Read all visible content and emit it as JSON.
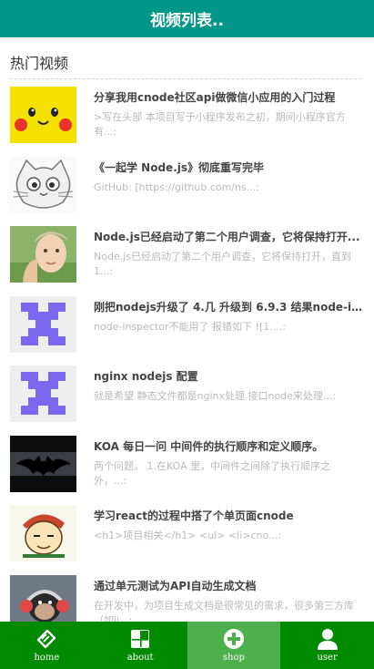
{
  "header": {
    "title": "视频列表.."
  },
  "section": {
    "title": "热门视频"
  },
  "videos": [
    {
      "title": "分享我用cnode社区api做微信小应用的入门过程",
      "summary": ">写在头部  本项目写于小程序发布之初，期间小程序官方有...:",
      "thumb": "pikachu"
    },
    {
      "title": "《一起学 Node.js》彻底重写完毕",
      "summary": "GitHub: [https://github.com/ns...:",
      "thumb": "cat-sketch"
    },
    {
      "title": "Node.js已经启动了第二个用户调查，它将保持打开...",
      "summary": "Node.js已经启动了第二个用户调查，它将保持打开，直到1...:",
      "thumb": "portrait"
    },
    {
      "title": "刚把nodejs升级了 4.几 升级到 6.9.3 结果node-ins...",
      "summary": "node-inspector不能用了 报错如下 ![1....:",
      "thumb": "identicon"
    },
    {
      "title": "nginx nodejs 配置",
      "summary": "就是希望 静态文件都是nginx处理 接口node来处理...:",
      "thumb": "identicon"
    },
    {
      "title": "KOA 每日一问 中间件的执行顺序和定义顺序。",
      "summary": "两个问题。 1.在KOA 里，中间件之间除了执行顺序之外，...:",
      "thumb": "batman"
    },
    {
      "title": "学习react的过程中搭了个单页面cnode",
      "summary": "<h1>项目相关</h1> <ul> <li>cno...:",
      "thumb": "cartoon-guy"
    },
    {
      "title": "通过单元测试为API自动生成文档",
      "summary": "在开发中，为项目生成文档是很常见的需求，很多第三方库（如jj...:",
      "thumb": "monkey-headphones"
    }
  ],
  "tabs": [
    {
      "label": "home",
      "icon": "ticket-icon",
      "active": false
    },
    {
      "label": "about",
      "icon": "grid-icon",
      "active": false
    },
    {
      "label": "shop",
      "icon": "plus-circle-icon",
      "active": true
    },
    {
      "label": "user",
      "icon": "user-icon",
      "active": false
    }
  ],
  "colors": {
    "header": "#009688",
    "tabbar": "#008a00",
    "tab_active": "#4cb04c",
    "identicon": "#7b68ee"
  }
}
